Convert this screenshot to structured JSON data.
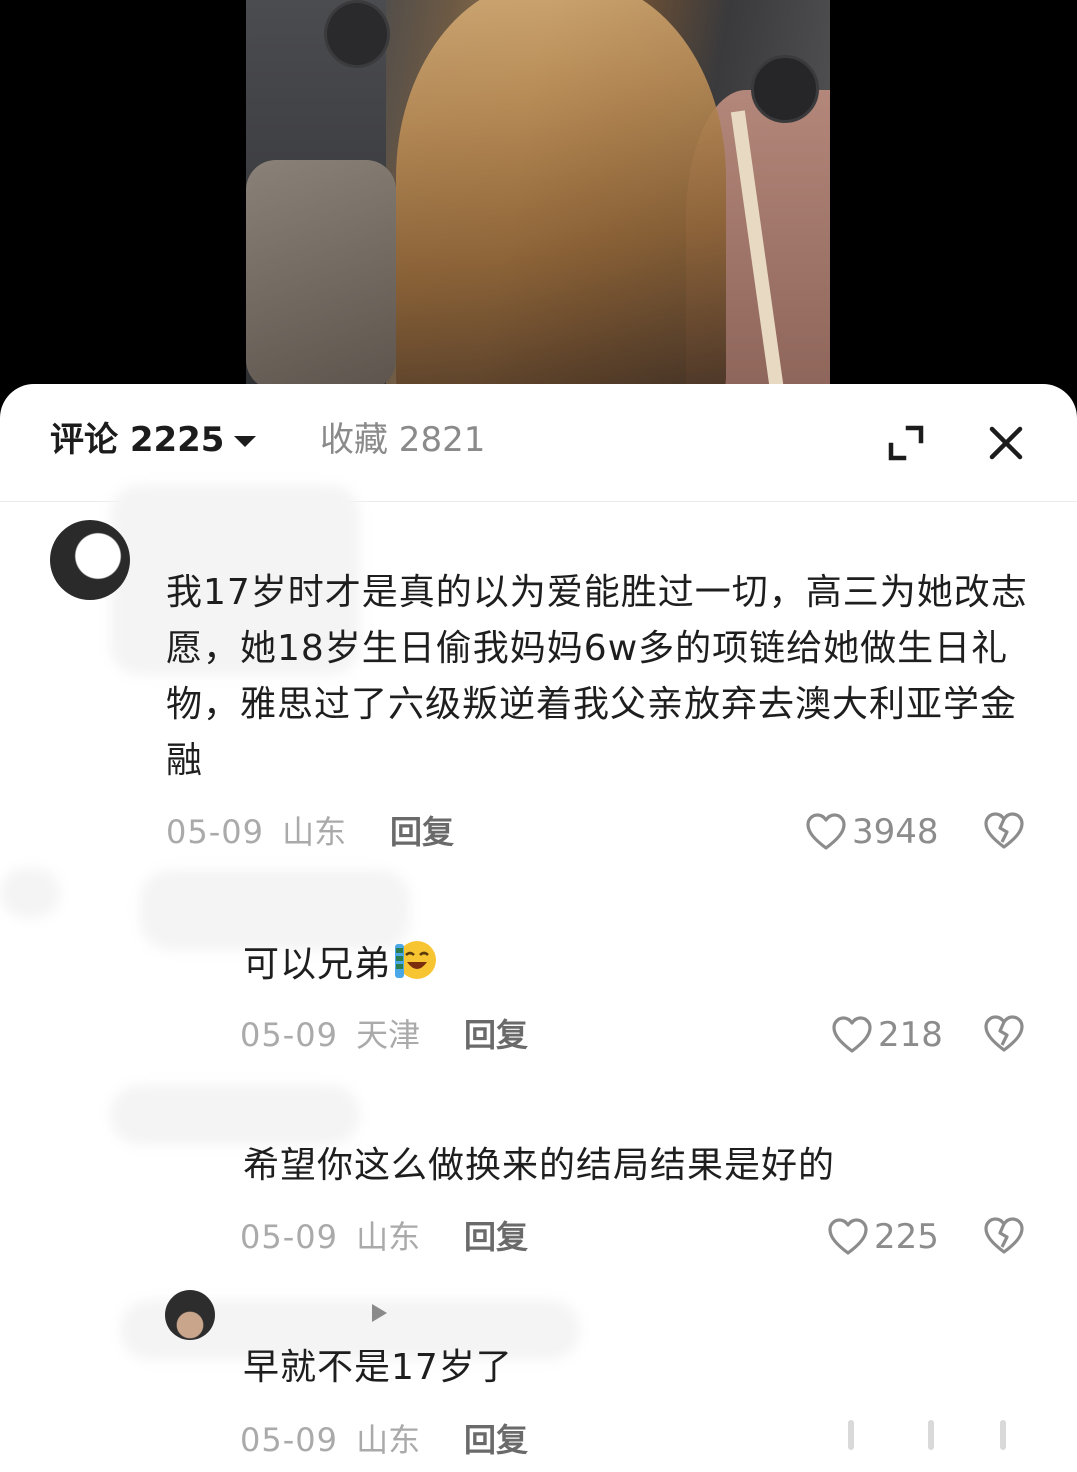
{
  "header": {
    "comments_label": "评论 2225",
    "favorites_label": "收藏 2821"
  },
  "icons": {
    "expand": "expand-icon",
    "close": "close-icon",
    "like": "heart-icon",
    "dislike": "broken-heart-icon",
    "emoji": "laughing-crying-emoji-icon"
  },
  "comments": [
    {
      "text": "我17岁时才是真的以为爱能胜过一切，高三为她改志愿，她18岁生日偷我妈妈6w多的项链给她做生日礼物，雅思过了六级叛逆着我父亲放弃去澳大利亚学金融",
      "date": "05-09",
      "location": "山东",
      "reply_label": "回复",
      "likes": "3948"
    },
    {
      "text": "可以兄弟",
      "date": "05-09",
      "location": "天津",
      "reply_label": "回复",
      "likes": "218"
    },
    {
      "text": "希望你这么做换来的结局结果是好的",
      "date": "05-09",
      "location": "山东",
      "reply_label": "回复",
      "likes": "225"
    },
    {
      "text": "早就不是17岁了",
      "date": "05-09",
      "location": "山东",
      "reply_label": "回复"
    }
  ],
  "colors": {
    "sheet_bg": "#ffffff",
    "primary_text": "#1e1e1e",
    "meta_text": "#aaaaaa",
    "reply_text": "#6a6a6a"
  }
}
